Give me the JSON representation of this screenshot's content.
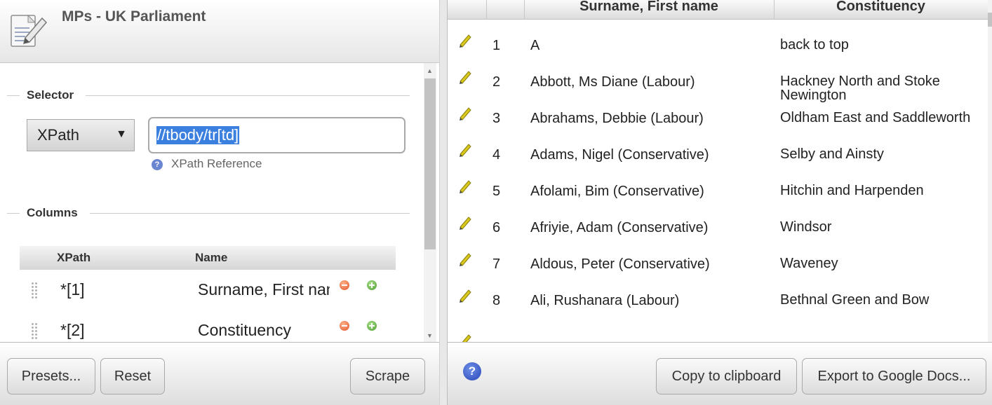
{
  "app": {
    "title": "MPs - UK Parliament"
  },
  "selector": {
    "section_label": "Selector",
    "type": "XPath",
    "expression": "//tbody/tr[td]",
    "reference_link": "XPath Reference"
  },
  "columns": {
    "section_label": "Columns",
    "headers": {
      "xpath": "XPath",
      "name": "Name"
    },
    "rows": [
      {
        "xpath": "*[1]",
        "name": "Surname, First name"
      },
      {
        "xpath": "*[2]",
        "name": "Constituency"
      }
    ]
  },
  "left_footer": {
    "presets": "Presets...",
    "reset": "Reset",
    "scrape": "Scrape"
  },
  "table": {
    "headers": [
      "Surname, First name",
      "Constituency"
    ],
    "rows": [
      {
        "num": "1",
        "name": "A",
        "constituency": "back to top"
      },
      {
        "num": "2",
        "name": "Abbott, Ms Diane (Labour)",
        "constituency": "Hackney North and Stoke Newington"
      },
      {
        "num": "3",
        "name": "Abrahams, Debbie (Labour)",
        "constituency": "Oldham East and Saddleworth"
      },
      {
        "num": "4",
        "name": "Adams, Nigel (Conservative)",
        "constituency": "Selby and Ainsty"
      },
      {
        "num": "5",
        "name": "Afolami, Bim (Conservative)",
        "constituency": "Hitchin and Harpenden"
      },
      {
        "num": "6",
        "name": "Afriyie, Adam (Conservative)",
        "constituency": "Windsor"
      },
      {
        "num": "7",
        "name": "Aldous, Peter (Conservative)",
        "constituency": "Waveney"
      },
      {
        "num": "8",
        "name": "Ali, Rushanara (Labour)",
        "constituency": "Bethnal Green and Bow"
      }
    ]
  },
  "right_footer": {
    "help": "?",
    "copy": "Copy to clipboard",
    "export": "Export to Google Docs..."
  }
}
